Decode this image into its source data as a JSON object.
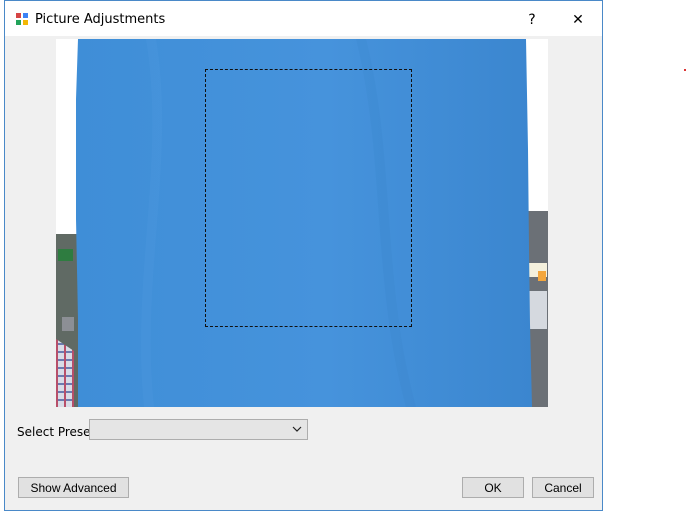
{
  "window": {
    "title": "Picture Adjustments",
    "help_glyph": "?",
    "close_glyph": "✕"
  },
  "preset": {
    "label": "Select Preset",
    "selected_value": ""
  },
  "buttons": {
    "show_advanced": "Show Advanced",
    "ok": "OK",
    "cancel": "Cancel"
  },
  "colors": {
    "accent_border": "#4a89c8",
    "preview_fabric": "#3d8fd9"
  },
  "icons": {
    "app": "picture-adjustments-icon",
    "help": "help-icon",
    "close": "close-icon",
    "dropdown": "chevron-down-icon"
  }
}
